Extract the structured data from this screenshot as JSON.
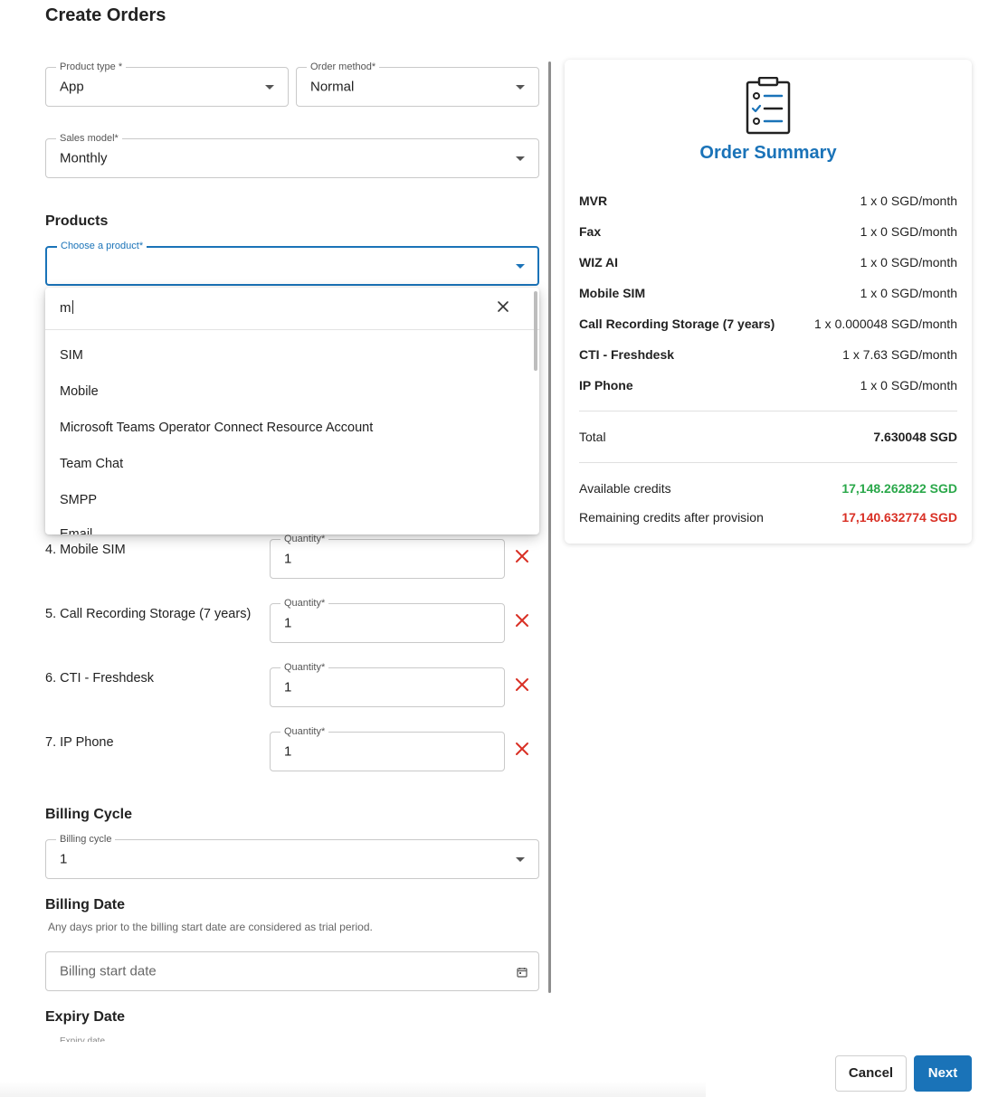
{
  "page": {
    "title": "Create Orders"
  },
  "form": {
    "product_type": {
      "label": "Product type *",
      "value": "App"
    },
    "order_method": {
      "label": "Order method*",
      "value": "Normal"
    },
    "sales_model": {
      "label": "Sales model*",
      "value": "Monthly"
    },
    "products_heading": "Products",
    "choose_product": {
      "label": "Choose a product*",
      "value": ""
    },
    "product_search": {
      "query": "m",
      "options": [
        "SIM",
        "Mobile",
        "Microsoft Teams Operator Connect Resource Account",
        "Team Chat",
        "SMPP",
        "Email"
      ]
    },
    "selected_products": [
      {
        "label": "4. Mobile SIM",
        "quantity_label": "Quantity*",
        "quantity": "1"
      },
      {
        "label": "5. Call Recording Storage (7 years)",
        "quantity_label": "Quantity*",
        "quantity": "1"
      },
      {
        "label": "6. CTI - Freshdesk",
        "quantity_label": "Quantity*",
        "quantity": "1"
      },
      {
        "label": "7. IP Phone",
        "quantity_label": "Quantity*",
        "quantity": "1"
      }
    ],
    "billing_cycle_heading": "Billing Cycle",
    "billing_cycle": {
      "label": "Billing cycle",
      "value": "1"
    },
    "billing_date_heading": "Billing Date",
    "billing_date_hint": "Any days prior to the billing start date are considered as trial period.",
    "billing_start_date": {
      "placeholder": "Billing start date"
    },
    "expiry_date_heading": "Expiry Date",
    "expiry_date": {
      "label": "Expiry date"
    }
  },
  "summary": {
    "title": "Order Summary",
    "items": [
      {
        "name": "MVR",
        "price": "1 x 0 SGD/month"
      },
      {
        "name": "Fax",
        "price": "1 x 0 SGD/month"
      },
      {
        "name": "WIZ AI",
        "price": "1 x 0 SGD/month"
      },
      {
        "name": "Mobile SIM",
        "price": "1 x 0 SGD/month"
      },
      {
        "name": "Call Recording Storage (7 years)",
        "price": "1 x 0.000048 SGD/month"
      },
      {
        "name": "CTI - Freshdesk",
        "price": "1 x 7.63 SGD/month"
      },
      {
        "name": "IP Phone",
        "price": "1 x 0 SGD/month"
      }
    ],
    "total_label": "Total",
    "total_value": "7.630048 SGD",
    "available_credits_label": "Available credits",
    "available_credits_value": "17,148.262822 SGD",
    "remaining_credits_label": "Remaining credits after provision",
    "remaining_credits_value": "17,140.632774 SGD"
  },
  "footer": {
    "cancel_label": "Cancel",
    "next_label": "Next"
  },
  "colors": {
    "primary": "#1a73b8",
    "success": "#2aa84a",
    "danger": "#d93025"
  },
  "icons": {
    "dropdown": "chevron-down-icon",
    "clear": "close-icon",
    "remove": "remove-x-icon",
    "calendar": "calendar-icon",
    "summary": "clipboard-checklist-icon"
  }
}
